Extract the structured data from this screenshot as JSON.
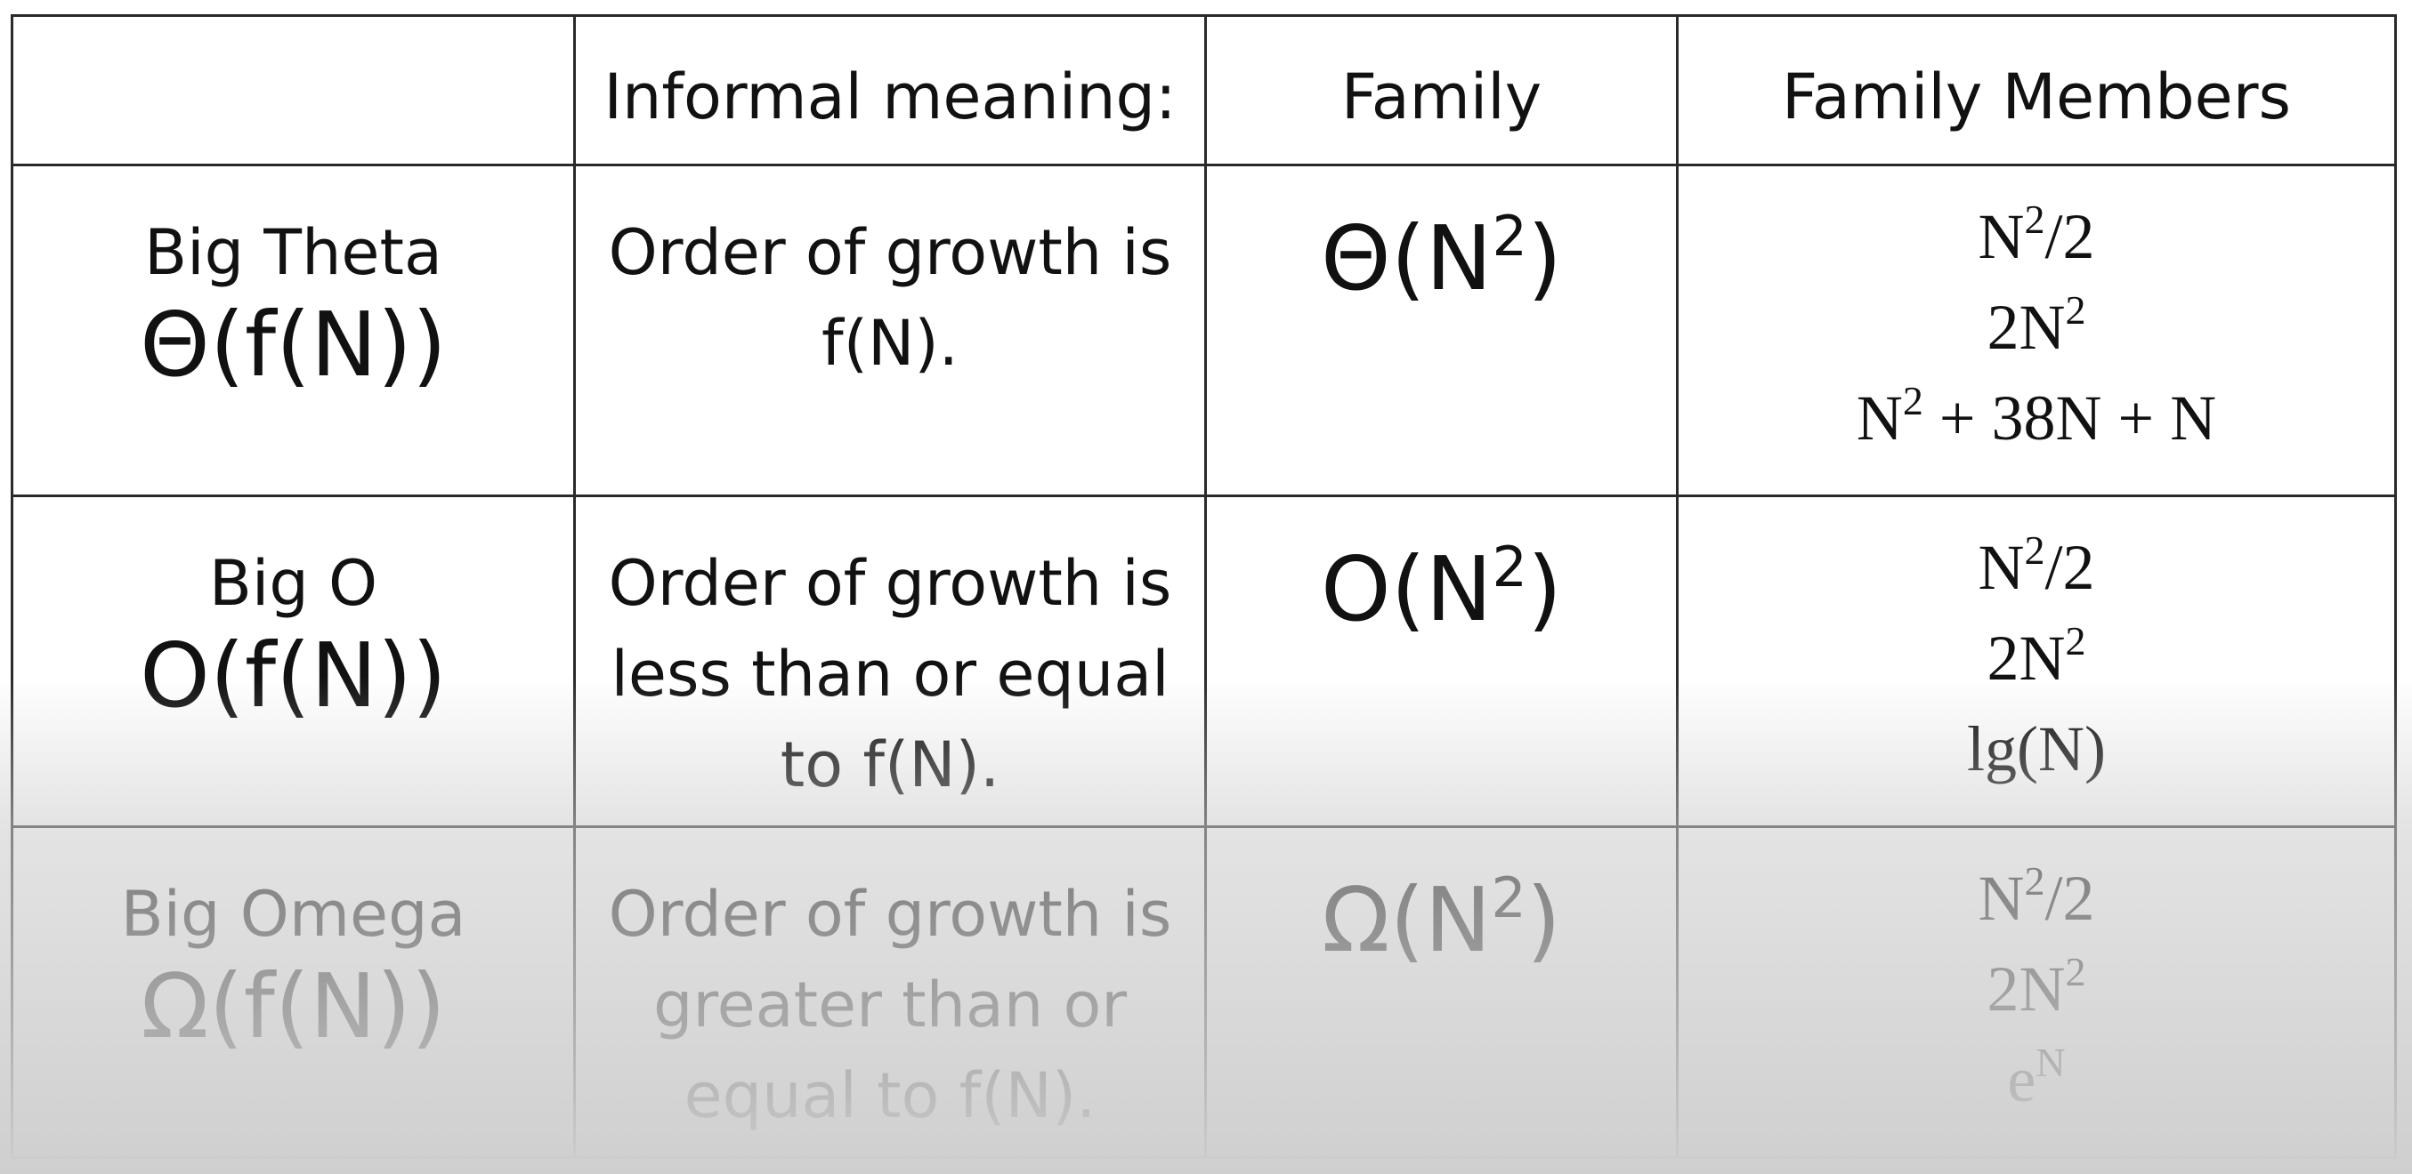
{
  "table": {
    "headers": [
      "",
      "Informal meaning:",
      "Family",
      "Family Members"
    ],
    "rows": [
      {
        "name": "Big Theta",
        "symbol": "Θ(f(N))",
        "meaning": "Order of growth is f(N).",
        "family": {
          "base": "Θ(N",
          "sup": "2",
          "close": ")"
        },
        "members": [
          [
            {
              "t": "N"
            },
            {
              "sup": "2"
            },
            {
              "t": "/2"
            }
          ],
          [
            {
              "t": "2N"
            },
            {
              "sup": "2"
            }
          ],
          [
            {
              "t": "N"
            },
            {
              "sup": "2"
            },
            {
              "t": " + 38N + N"
            }
          ]
        ]
      },
      {
        "name": "Big O",
        "symbol": "O(f(N))",
        "meaning": "Order of growth is less than or equal to f(N).",
        "family": {
          "base": "O(N",
          "sup": "2",
          "close": ")"
        },
        "members": [
          [
            {
              "t": "N"
            },
            {
              "sup": "2"
            },
            {
              "t": "/2"
            }
          ],
          [
            {
              "t": "2N"
            },
            {
              "sup": "2"
            }
          ],
          [
            {
              "t": "lg(N)"
            }
          ]
        ]
      },
      {
        "name": "Big Omega",
        "symbol": "Ω(f(N))",
        "meaning": "Order of growth is greater than or equal to f(N).",
        "family": {
          "base": "Ω(N",
          "sup": "2",
          "close": ")"
        },
        "members": [
          [
            {
              "t": "N"
            },
            {
              "sup": "2"
            },
            {
              "t": "/2"
            }
          ],
          [
            {
              "t": "2N"
            },
            {
              "sup": "2"
            }
          ],
          [
            {
              "t": "e"
            },
            {
              "sup": "N"
            }
          ]
        ]
      }
    ]
  }
}
